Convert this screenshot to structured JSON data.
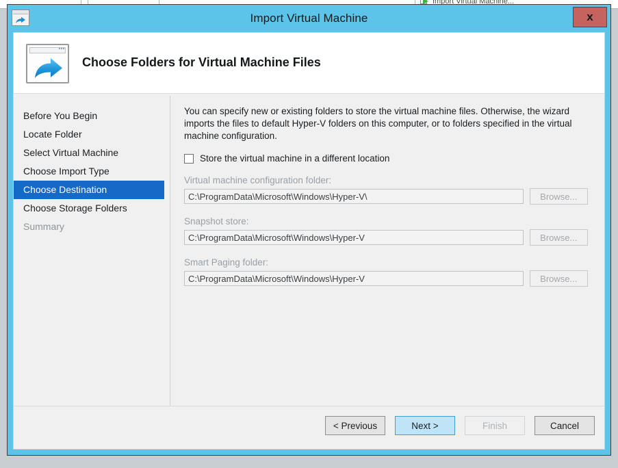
{
  "background": {
    "menu_item_label": "Import Virtual Machine...",
    "menu_icon": "green-arrow-import-icon"
  },
  "window": {
    "title": "Import Virtual Machine",
    "titlebar_icon": "import-arrow-icon",
    "close_label": "x",
    "titlebar_color": "#5bc4e8",
    "close_color": "#c4635f"
  },
  "header": {
    "icon": "import-arrow-window-icon",
    "title": "Choose Folders for Virtual Machine Files"
  },
  "sidebar": {
    "items": [
      {
        "label": "Before You Begin",
        "state": "normal"
      },
      {
        "label": "Locate Folder",
        "state": "normal"
      },
      {
        "label": "Select Virtual Machine",
        "state": "normal"
      },
      {
        "label": "Choose Import Type",
        "state": "normal"
      },
      {
        "label": "Choose Destination",
        "state": "selected"
      },
      {
        "label": "Choose Storage Folders",
        "state": "normal"
      },
      {
        "label": "Summary",
        "state": "disabled"
      }
    ],
    "selected_color": "#1569c7"
  },
  "main": {
    "intro_text": "You can specify new or existing folders to store the virtual machine files. Otherwise, the wizard imports the files to default Hyper-V folders on this computer, or to folders specified in the virtual machine configuration.",
    "checkbox": {
      "label": "Store the virtual machine in a different location",
      "checked": false
    },
    "fields": [
      {
        "label": "Virtual machine configuration folder:",
        "value": "C:\\ProgramData\\Microsoft\\Windows\\Hyper-V\\",
        "browse_label": "Browse...",
        "disabled": true
      },
      {
        "label": "Snapshot store:",
        "value": "C:\\ProgramData\\Microsoft\\Windows\\Hyper-V",
        "browse_label": "Browse...",
        "disabled": true
      },
      {
        "label": "Smart Paging folder:",
        "value": "C:\\ProgramData\\Microsoft\\Windows\\Hyper-V",
        "browse_label": "Browse...",
        "disabled": true
      }
    ]
  },
  "footer": {
    "buttons": [
      {
        "label": "< Previous",
        "style": "normal"
      },
      {
        "label": "Next >",
        "style": "primary"
      },
      {
        "label": "Finish",
        "style": "disabled"
      },
      {
        "label": "Cancel",
        "style": "normal"
      }
    ]
  }
}
